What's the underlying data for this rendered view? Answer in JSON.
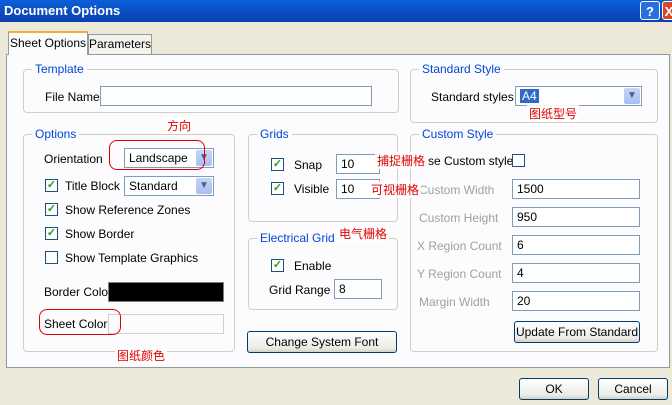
{
  "window": {
    "title": "Document Options",
    "help_label": "?",
    "close_label": "X"
  },
  "tabs": [
    {
      "label": "Sheet Options",
      "active": true
    },
    {
      "label": "Parameters",
      "active": false
    }
  ],
  "template": {
    "title": "Template",
    "file_name_label": "File Name",
    "file_name_value": ""
  },
  "options": {
    "title": "Options",
    "orientation_label": "Orientation",
    "orientation_value": "Landscape",
    "title_block_label": "Title Block",
    "title_block_checked": true,
    "title_block_value": "Standard",
    "show_reference_zones_label": "Show Reference Zones",
    "show_reference_zones_checked": true,
    "show_border_label": "Show Border",
    "show_border_checked": true,
    "show_template_graphics_label": "Show Template Graphics",
    "show_template_graphics_checked": false,
    "border_color_label": "Border Color",
    "border_color": "#000000",
    "sheet_color_label": "Sheet Color",
    "sheet_color": "#fcfcfe"
  },
  "grids": {
    "title": "Grids",
    "snap_label": "Snap",
    "snap_checked": true,
    "snap_value": "10",
    "visible_label": "Visible",
    "visible_checked": true,
    "visible_value": "10"
  },
  "electrical_grid": {
    "title": "Electrical Grid",
    "enable_label": "Enable",
    "enable_checked": true,
    "grid_range_label": "Grid Range",
    "grid_range_value": "8"
  },
  "change_system_font_label": "Change System Font",
  "standard_style": {
    "title": "Standard Style",
    "label": "Standard styles",
    "value": "A4"
  },
  "custom_style": {
    "title": "Custom Style",
    "use_custom_label": "se Custom style",
    "use_custom_checked": false,
    "custom_width_label": "Custom Width",
    "custom_width_value": "1500",
    "custom_height_label": "Custom Height",
    "custom_height_value": "950",
    "x_region_label": "X Region Count",
    "x_region_value": "6",
    "y_region_label": "Y Region Count",
    "y_region_value": "4",
    "margin_width_label": "Margin Width",
    "margin_width_value": "20",
    "update_button": "Update From Standard"
  },
  "footer": {
    "ok_label": "OK",
    "cancel_label": "Cancel"
  },
  "annotations": {
    "orientation_note": "方向",
    "snap_note": "捕捉栅格",
    "visible_note": "可视栅格",
    "electrical_note": "电气栅格",
    "paper_size_note": "图纸型号",
    "sheet_color_note": "图纸颜色"
  },
  "colors": {
    "accent": "#0046d5",
    "annotation": "#e00000",
    "selection": "#316ac5",
    "checkmark": "#21a121"
  }
}
